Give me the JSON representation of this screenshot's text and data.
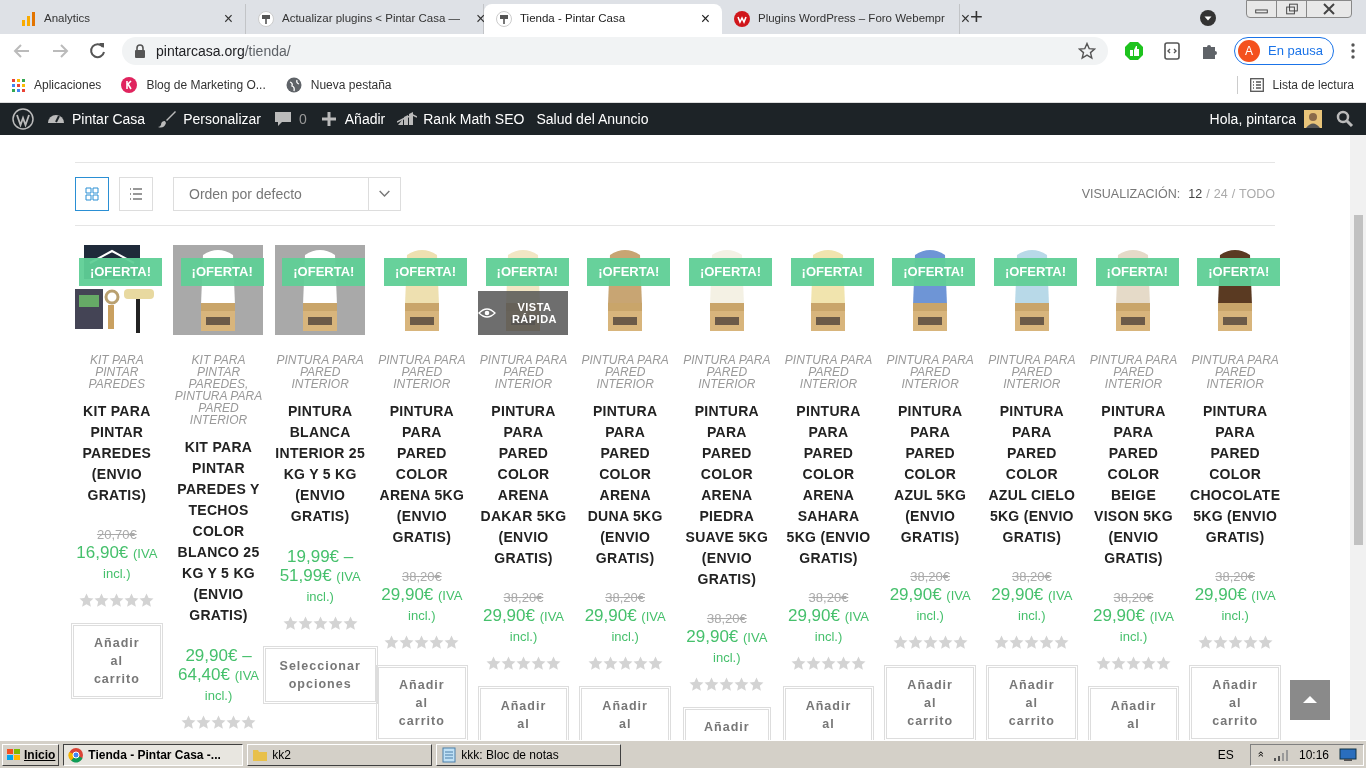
{
  "tabs": [
    {
      "kind": "analytics",
      "label": "Analytics",
      "selected": false,
      "close": "×"
    },
    {
      "kind": "site",
      "label": "Actualizar plugins < Pintar Casa —",
      "selected": false,
      "close": "×"
    },
    {
      "kind": "site",
      "label": "Tienda - Pintar Casa",
      "selected": true,
      "close": "×"
    },
    {
      "kind": "forum",
      "label": "Plugins WordPress – Foro Webempr",
      "selected": false,
      "close": "×"
    }
  ],
  "new_tab": "+",
  "address_bar": {
    "host": "pintarcasa.org",
    "path": "/tienda/"
  },
  "profile": {
    "initial": "A",
    "label": "En pausa"
  },
  "bookmarks": [
    {
      "kind": "apps",
      "label": "Aplicaciones"
    },
    {
      "kind": "blog",
      "label": "Blog de Marketing O..."
    },
    {
      "kind": "globe",
      "label": "Nueva pestaña"
    }
  ],
  "reading_list": "Lista de lectura",
  "admin_bar": {
    "items": [
      {
        "kind": "site",
        "label": "Pintar Casa"
      },
      {
        "kind": "customize",
        "label": "Personalizar"
      },
      {
        "kind": "comments",
        "label": "0"
      },
      {
        "kind": "add",
        "label": "Añadir"
      },
      {
        "kind": "seo",
        "label": "Rank Math SEO"
      },
      {
        "kind": "plain",
        "label": "Salud del Anuncio"
      }
    ],
    "greeting": "Hola, pintarca"
  },
  "shop_toolbar": {
    "views": [
      {
        "kind": "grid",
        "selected": true
      },
      {
        "kind": "list",
        "selected": false
      }
    ],
    "sort": "Orden por defecto",
    "per_page": {
      "label": "VISUALIZACIÓN:",
      "separator": "/",
      "options": [
        {
          "label": "12",
          "selected": true
        },
        {
          "label": "24",
          "selected": false
        },
        {
          "label": "TODO",
          "selected": false
        }
      ]
    }
  },
  "products": [
    {
      "badge": "¡OFERTA!",
      "category": "KIT PARA PINTAR PAREDES",
      "title": "KIT PARA PINTAR PAREDES (ENVIO GRATIS)",
      "old_price": "20,70€",
      "price": "16,90€",
      "tax": "(IVA incl.)",
      "stars": 0,
      "button": "Añadir al carrito"
    },
    {
      "badge": "¡OFERTA!",
      "category": "KIT PARA PINTAR PAREDES, PINTURA PARA PARED INTERIOR",
      "title": "KIT PARA PINTAR PAREDES Y TECHOS COLOR BLANCO 25 KG Y 5 KG (ENVIO GRATIS)",
      "price": "29,90€ – 64,40€",
      "tax": "(IVA incl.)",
      "stars": 0
    },
    {
      "badge": "¡OFERTA!",
      "category": "PINTURA PARA PARED INTERIOR",
      "title": "PINTURA BLANCA INTERIOR 25 KG Y 5 KG (ENVIO GRATIS)",
      "price": "19,99€ – 51,99€",
      "tax": "(IVA incl.)",
      "stars": 0,
      "button": "Seleccionar opciones"
    },
    {
      "badge": "¡OFERTA!",
      "category": "PINTURA PARA PARED INTERIOR",
      "title": "PINTURA PARA PARED COLOR ARENA 5KG (ENVIO GRATIS)",
      "old_price": "38,20€",
      "price": "29,90€",
      "tax": "(IVA incl.)",
      "stars": 0,
      "button": "Añadir al carrito"
    },
    {
      "badge": "¡OFERTA!",
      "quick_view": "VISTA RÁPIDA",
      "category": "PINTURA PARA PARED INTERIOR",
      "title": "PINTURA PARA PARED COLOR ARENA DAKAR 5KG (ENVIO GRATIS)",
      "old_price": "38,20€",
      "price": "29,90€",
      "tax": "(IVA incl.)",
      "stars": 0,
      "button": "Añadir al"
    },
    {
      "badge": "¡OFERTA!",
      "category": "PINTURA PARA PARED INTERIOR",
      "title": "PINTURA PARA PARED COLOR ARENA DUNA 5KG (ENVIO GRATIS)",
      "old_price": "38,20€",
      "price": "29,90€",
      "tax": "(IVA incl.)",
      "stars": 0,
      "button": "Añadir al"
    },
    {
      "badge": "¡OFERTA!",
      "category": "PINTURA PARA PARED INTERIOR",
      "title": "PINTURA PARA PARED COLOR ARENA PIEDRA SUAVE 5KG (ENVIO GRATIS)",
      "old_price": "38,20€",
      "price": "29,90€",
      "tax": "(IVA incl.)",
      "stars": 0,
      "button": "Añadir"
    },
    {
      "badge": "¡OFERTA!",
      "category": "PINTURA PARA PARED INTERIOR",
      "title": "PINTURA PARA PARED COLOR ARENA SAHARA 5KG (ENVIO GRATIS)",
      "old_price": "38,20€",
      "price": "29,90€",
      "tax": "(IVA incl.)",
      "stars": 0,
      "button": "Añadir al"
    },
    {
      "badge": "¡OFERTA!",
      "category": "PINTURA PARA PARED INTERIOR",
      "title": "PINTURA PARA PARED COLOR AZUL 5KG (ENVIO GRATIS)",
      "old_price": "38,20€",
      "price": "29,90€",
      "tax": "(IVA incl.)",
      "stars": 0,
      "button": "Añadir al carrito"
    },
    {
      "badge": "¡OFERTA!",
      "category": "PINTURA PARA PARED INTERIOR",
      "title": "PINTURA PARA PARED COLOR AZUL CIELO 5KG (ENVIO GRATIS)",
      "old_price": "38,20€",
      "price": "29,90€",
      "tax": "(IVA incl.)",
      "stars": 0,
      "button": "Añadir al carrito"
    },
    {
      "badge": "¡OFERTA!",
      "category": "PINTURA PARA PARED INTERIOR",
      "title": "PINTURA PARA PARED COLOR BEIGE VISON 5KG (ENVIO GRATIS)",
      "old_price": "38,20€",
      "price": "29,90€",
      "tax": "(IVA incl.)",
      "stars": 0,
      "button": "Añadir al"
    },
    {
      "badge": "¡OFERTA!",
      "category": "PINTURA PARA PARED INTERIOR",
      "title": "PINTURA PARA PARED COLOR CHOCOLATE 5KG (ENVIO GRATIS)",
      "old_price": "38,20€",
      "price": "29,90€",
      "tax": "(IVA incl.)",
      "stars": 0,
      "button": "Añadir al carrito"
    }
  ],
  "taskbar": {
    "start": "Inicio",
    "tasks": [
      {
        "kind": "chrome",
        "label": "Tienda - Pintar Casa -...",
        "selected": true
      },
      {
        "kind": "folder",
        "label": "kk2",
        "selected": false
      },
      {
        "kind": "notepad",
        "label": "kkk: Bloc de notas",
        "selected": false
      }
    ],
    "language": "ES",
    "tray_toggle": "»",
    "time": "10:16"
  }
}
